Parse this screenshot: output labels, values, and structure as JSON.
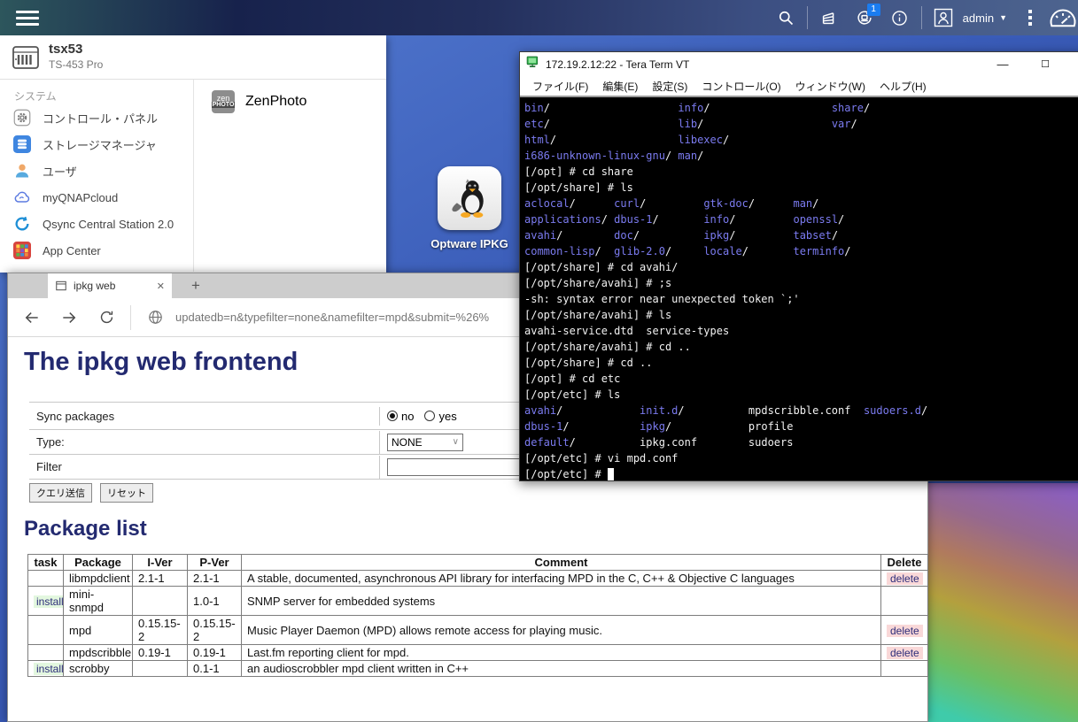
{
  "colors": {
    "badge_blue": "#1a7cf0",
    "heading_navy": "#232a70",
    "terminal_dir_blue": "#7b7bf0",
    "install_bg": "#e3f7df",
    "delete_bg": "#f9d8d8"
  },
  "topbar": {
    "user": "admin",
    "badge_count": "1"
  },
  "sidebar": {
    "device_name": "tsx53",
    "device_model": "TS-453 Pro",
    "section_label": "システム",
    "items": [
      {
        "label": "コントロール・パネル",
        "icon": "gear"
      },
      {
        "label": "ストレージマネージャ",
        "icon": "storage"
      },
      {
        "label": "ユーザ",
        "icon": "user"
      },
      {
        "label": "myQNAPcloud",
        "icon": "cloud"
      },
      {
        "label": "Qsync Central Station 2.0",
        "icon": "qsync"
      },
      {
        "label": "App Center",
        "icon": "appcenter"
      }
    ],
    "second_column_items": [
      {
        "label": "ZenPhoto",
        "icon": "zenphoto"
      }
    ]
  },
  "desktop": {
    "shortcut_label": "Optware IPKG"
  },
  "terminal_window": {
    "title": "172.19.2.12:22 - Tera Term VT",
    "menus": [
      "ファイル(F)",
      "編集(E)",
      "設定(S)",
      "コントロール(O)",
      "ウィンドウ(W)",
      "ヘルプ(H)"
    ],
    "lines": [
      [
        [
          "bin",
          "d"
        ],
        [
          "/                    ",
          "w"
        ],
        [
          "info",
          "d"
        ],
        [
          "/                   ",
          "w"
        ],
        [
          "share",
          "d"
        ],
        [
          "/",
          "w"
        ]
      ],
      [
        [
          "etc",
          "d"
        ],
        [
          "/                    ",
          "w"
        ],
        [
          "lib",
          "d"
        ],
        [
          "/                    ",
          "w"
        ],
        [
          "var",
          "d"
        ],
        [
          "/",
          "w"
        ]
      ],
      [
        [
          "html",
          "d"
        ],
        [
          "/                   ",
          "w"
        ],
        [
          "libexec",
          "d"
        ],
        [
          "/",
          "w"
        ]
      ],
      [
        [
          "i686-unknown-linux-gnu",
          "d"
        ],
        [
          "/ ",
          "w"
        ],
        [
          "man",
          "d"
        ],
        [
          "/",
          "w"
        ]
      ],
      [
        [
          "[/opt] # cd share",
          "w"
        ]
      ],
      [
        [
          "[/opt/share] # ls",
          "w"
        ]
      ],
      [
        [
          "aclocal",
          "d"
        ],
        [
          "/      ",
          "w"
        ],
        [
          "curl",
          "d"
        ],
        [
          "/         ",
          "w"
        ],
        [
          "gtk-doc",
          "d"
        ],
        [
          "/      ",
          "w"
        ],
        [
          "man",
          "d"
        ],
        [
          "/",
          "w"
        ]
      ],
      [
        [
          "applications",
          "d"
        ],
        [
          "/ ",
          "w"
        ],
        [
          "dbus-1",
          "d"
        ],
        [
          "/       ",
          "w"
        ],
        [
          "info",
          "d"
        ],
        [
          "/         ",
          "w"
        ],
        [
          "openssl",
          "d"
        ],
        [
          "/",
          "w"
        ]
      ],
      [
        [
          "avahi",
          "d"
        ],
        [
          "/        ",
          "w"
        ],
        [
          "doc",
          "d"
        ],
        [
          "/          ",
          "w"
        ],
        [
          "ipkg",
          "d"
        ],
        [
          "/         ",
          "w"
        ],
        [
          "tabset",
          "d"
        ],
        [
          "/",
          "w"
        ]
      ],
      [
        [
          "common-lisp",
          "d"
        ],
        [
          "/  ",
          "w"
        ],
        [
          "glib-2.0",
          "d"
        ],
        [
          "/     ",
          "w"
        ],
        [
          "locale",
          "d"
        ],
        [
          "/       ",
          "w"
        ],
        [
          "terminfo",
          "d"
        ],
        [
          "/",
          "w"
        ]
      ],
      [
        [
          "[/opt/share] # cd avahi/",
          "w"
        ]
      ],
      [
        [
          "[/opt/share/avahi] # ;s",
          "w"
        ]
      ],
      [
        [
          "-sh: syntax error near unexpected token `;'",
          "w"
        ]
      ],
      [
        [
          "[/opt/share/avahi] # ls",
          "w"
        ]
      ],
      [
        [
          "avahi-service.dtd  service-types",
          "w"
        ]
      ],
      [
        [
          "[/opt/share/avahi] # cd ..",
          "w"
        ]
      ],
      [
        [
          "[/opt/share] # cd ..",
          "w"
        ]
      ],
      [
        [
          "[/opt] # cd etc",
          "w"
        ]
      ],
      [
        [
          "[/opt/etc] # ls",
          "w"
        ]
      ],
      [
        [
          "avahi",
          "d"
        ],
        [
          "/            ",
          "w"
        ],
        [
          "init.d",
          "d"
        ],
        [
          "/          ",
          "w"
        ],
        [
          "mpdscribble.conf  ",
          "w"
        ],
        [
          "sudoers.d",
          "d"
        ],
        [
          "/",
          "w"
        ]
      ],
      [
        [
          "dbus-1",
          "d"
        ],
        [
          "/           ",
          "w"
        ],
        [
          "ipkg",
          "d"
        ],
        [
          "/            ",
          "w"
        ],
        [
          "profile",
          "w"
        ]
      ],
      [
        [
          "default",
          "d"
        ],
        [
          "/          ",
          "w"
        ],
        [
          "ipkg.conf        ",
          "w"
        ],
        [
          "sudoers",
          "w"
        ]
      ],
      [
        [
          "[/opt/etc] # vi mpd.conf",
          "w"
        ]
      ],
      [
        [
          "[/opt/etc] # ",
          "w"
        ],
        [
          " ",
          "cursor"
        ]
      ]
    ]
  },
  "browser": {
    "tab_title": "ipkg web",
    "url": "updatedb=n&typefilter=none&namefilter=mpd&submit=%26%",
    "page": {
      "title": "The ipkg web frontend",
      "form": {
        "sync_label": "Sync packages",
        "radio_options": [
          "no",
          "yes"
        ],
        "radio_selected": "no",
        "type_label": "Type:",
        "type_value": "NONE",
        "filter_label": "Filter",
        "filter_value": "",
        "submit_label": "クエリ送信",
        "reset_label": "リセット"
      },
      "list_title": "Package list",
      "table": {
        "headers": [
          "task",
          "Package",
          "I-Ver",
          "P-Ver",
          "Comment",
          "Delete"
        ],
        "install_label": "install",
        "delete_label": "delete",
        "rows": [
          {
            "task": "",
            "package": "libmpdclient",
            "iver": "2.1-1",
            "pver": "2.1-1",
            "comment": "A stable, documented, asynchronous API library for interfacing MPD in the C, C++ & Objective C languages",
            "delete": true
          },
          {
            "task": "install",
            "package": "mini-snmpd",
            "iver": "",
            "pver": "1.0-1",
            "comment": "SNMP server for embedded systems",
            "delete": false
          },
          {
            "task": "",
            "package": "mpd",
            "iver": "0.15.15-2",
            "pver": "0.15.15-2",
            "comment": "Music Player Daemon (MPD) allows remote access for playing music.",
            "delete": true
          },
          {
            "task": "",
            "package": "mpdscribble",
            "iver": "0.19-1",
            "pver": "0.19-1",
            "comment": "Last.fm reporting client for mpd.",
            "delete": true
          },
          {
            "task": "install",
            "package": "scrobby",
            "iver": "",
            "pver": "0.1-1",
            "comment": "an audioscrobbler mpd client written in C++",
            "delete": false
          }
        ]
      }
    }
  }
}
